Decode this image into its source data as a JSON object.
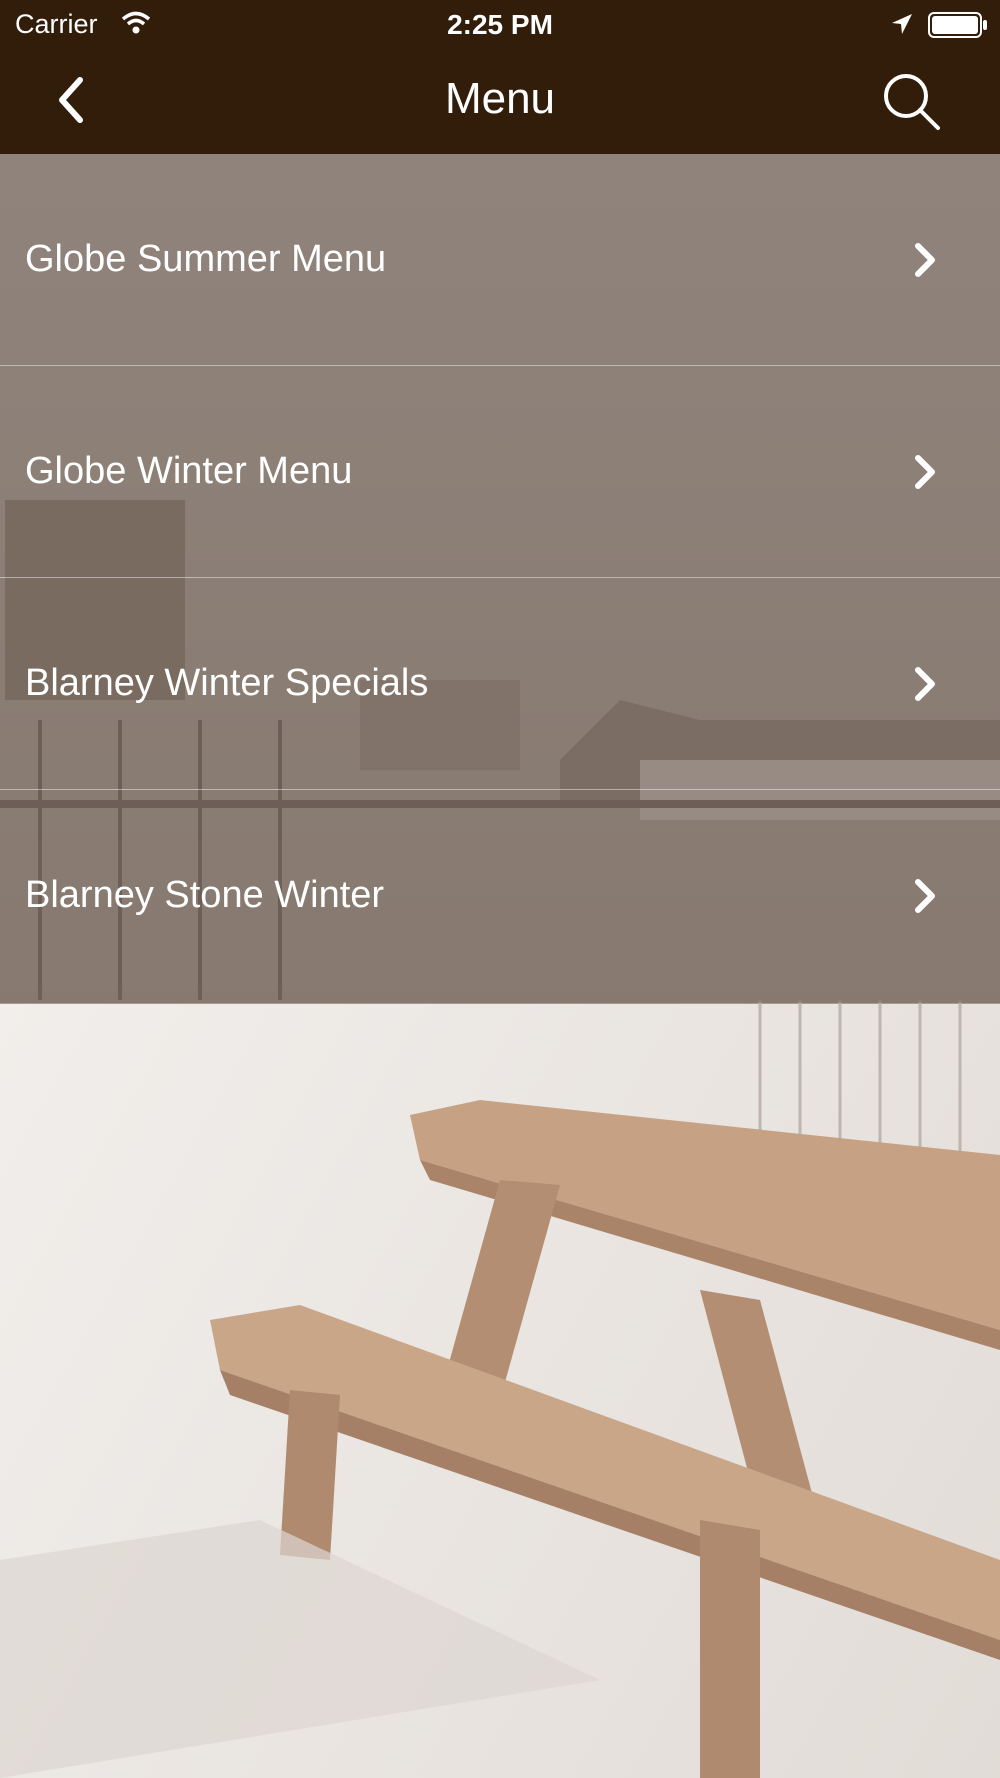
{
  "status_bar": {
    "carrier": "Carrier",
    "time": "2:25 PM"
  },
  "nav": {
    "title": "Menu",
    "back_icon": "chevron-left-icon",
    "search_icon": "search-icon"
  },
  "menu": {
    "items": [
      {
        "label": "Globe Summer Menu"
      },
      {
        "label": "Globe Winter Menu"
      },
      {
        "label": "Blarney Winter Specials"
      },
      {
        "label": "Blarney Stone Winter"
      }
    ]
  },
  "colors": {
    "nav_bar": "#321d0b",
    "row_overlay": "rgba(110,95,85,0.55)",
    "text": "#ffffff"
  }
}
